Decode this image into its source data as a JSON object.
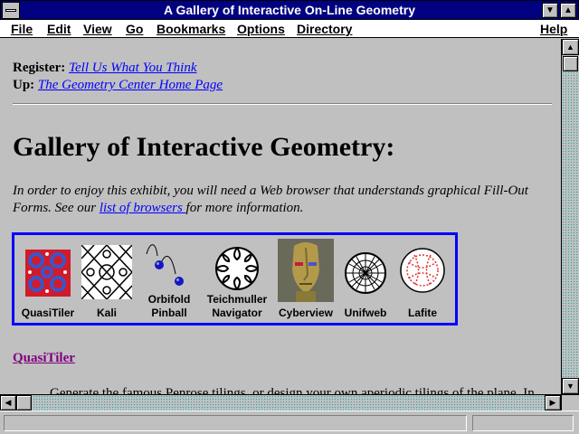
{
  "window": {
    "title": "A Gallery of Interactive On-Line Geometry"
  },
  "menu": [
    "File",
    "Edit",
    "View",
    "Go",
    "Bookmarks",
    "Options",
    "Directory",
    "Help"
  ],
  "page": {
    "register_label": "Register:",
    "register_link": "Tell Us What You Think",
    "up_label": "Up:",
    "up_link": "The Geometry Center Home Page",
    "heading": "Gallery of Interactive Geometry:",
    "intro_before": "In order to enjoy this exhibit, you will need a Web browser that understands graphical Fill-Out Forms. See our ",
    "intro_link": "list of browsers ",
    "intro_after": "for more information.",
    "gallery": [
      {
        "label": "QuasiTiler",
        "icon": "quasitiler-tile-icon"
      },
      {
        "label": "Kali",
        "icon": "kali-pattern-icon"
      },
      {
        "label": "Orbifold Pinball",
        "icon": "pinball-icon"
      },
      {
        "label": "Teichmuller Navigator",
        "icon": "teichmuller-disk-icon"
      },
      {
        "label": "Cyberview",
        "icon": "cyberview-head-icon"
      },
      {
        "label": "Unifweb",
        "icon": "unifweb-sphere-icon"
      },
      {
        "label": "Lafite",
        "icon": "lafite-disk-icon"
      }
    ],
    "section_link": "QuasiTiler",
    "section_text": "Generate the famous Penrose tilings, or design your own aperiodic tilings of the plane. In"
  },
  "colors": {
    "titlebar": "#000080",
    "link": "#0000ff",
    "visited": "#800080",
    "gallery_border": "#0000ff"
  }
}
